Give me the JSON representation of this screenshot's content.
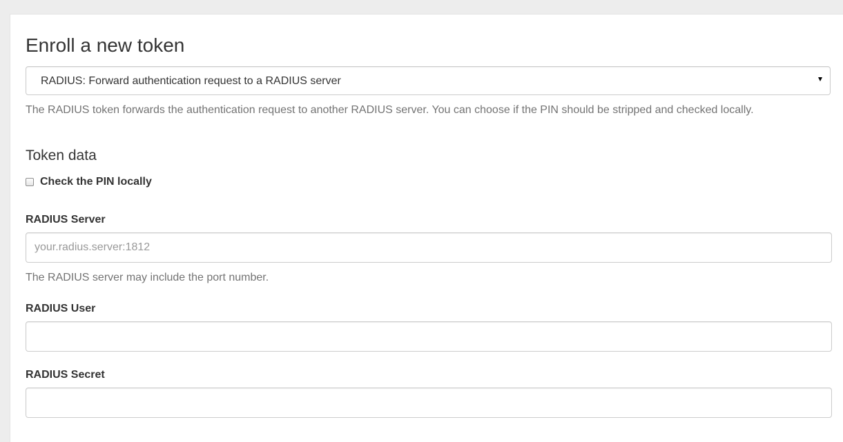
{
  "enroll": {
    "title": "Enroll a new token",
    "token_type_selected": "RADIUS: Forward authentication request to a RADIUS server",
    "token_type_description": "The RADIUS token forwards the authentication request to another RADIUS server. You can choose if the PIN should be stripped and checked locally."
  },
  "token_data": {
    "title": "Token data",
    "check_pin_label": "Check the PIN locally",
    "check_pin_checked": false,
    "radius_server": {
      "label": "RADIUS Server",
      "value": "",
      "placeholder": "your.radius.server:1812",
      "help": "The RADIUS server may include the port number."
    },
    "radius_user": {
      "label": "RADIUS User",
      "value": "",
      "placeholder": ""
    },
    "radius_secret": {
      "label": "RADIUS Secret",
      "value": "",
      "placeholder": ""
    }
  },
  "colors": {
    "help_text": "#737373",
    "border": "#cccccc",
    "background": "#ededed"
  },
  "icons": {
    "select_arrow": "caret-down-icon"
  }
}
